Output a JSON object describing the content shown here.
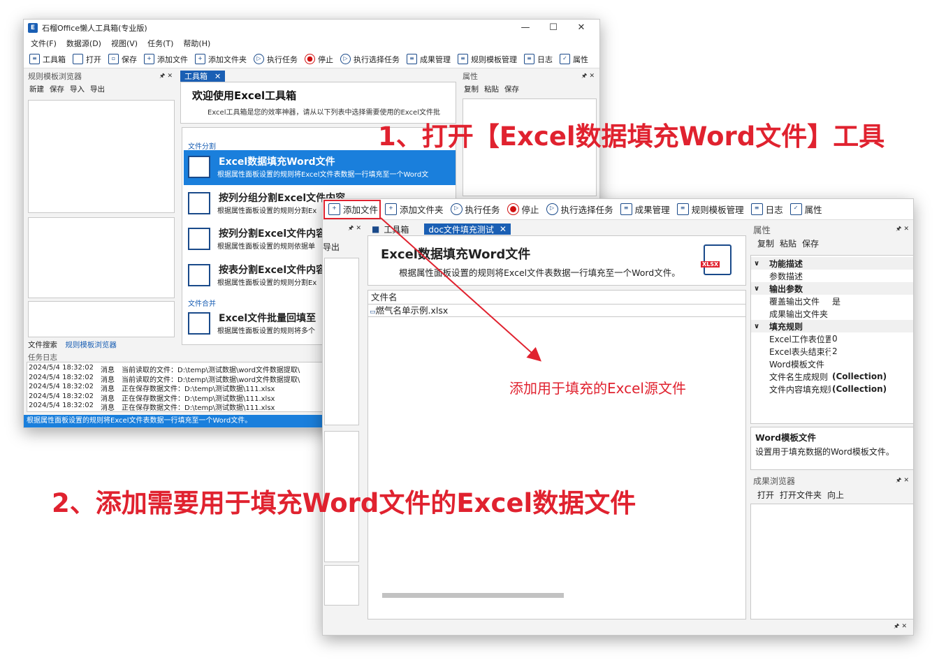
{
  "win1": {
    "title": "石榴Office懒人工具箱(专业版)",
    "app_icon": "E",
    "menu": [
      "文件(F)",
      "数据源(D)",
      "视图(V)",
      "任务(T)",
      "帮助(H)"
    ],
    "toolbar": [
      "工具箱",
      "打开",
      "保存",
      "添加文件",
      "添加文件夹",
      "执行任务",
      "停止",
      "执行选择任务",
      "成果管理",
      "规则模板管理",
      "日志",
      "属性"
    ],
    "rule_browser": {
      "title": "规则模板浏览器",
      "tools": [
        "新建",
        "保存",
        "导入",
        "导出"
      ],
      "tabs": [
        "文件搜索",
        "规则模板浏览器"
      ]
    },
    "tab_label": "工具箱",
    "welcome": {
      "title": "欢迎使用Excel工具箱",
      "desc": "Excel工具箱是您的效率神器，请从以下列表中选择需要使用的Excel文件批"
    },
    "group1": "文件分割",
    "group2": "文件合并",
    "tools": [
      {
        "title": "Excel数据填充Word文件",
        "desc": "根据属性面板设置的规则将Excel文件表数据一行填充至一个Word文"
      },
      {
        "title": "按列分组分割Excel文件内容",
        "desc": "根据属性面板设置的规则分割Ex"
      },
      {
        "title": "按列分割Excel文件内容",
        "desc": "根据属性面板设置的规则依据单"
      },
      {
        "title": "按表分割Excel文件内容",
        "desc": "根据属性面板设置的规则分割Ex"
      },
      {
        "title": "Excel文件批量回填至",
        "desc": "根据属性面板设置的规则将多个"
      }
    ],
    "props": {
      "title": "属性",
      "tools": [
        "复制",
        "粘贴",
        "保存"
      ]
    },
    "log": {
      "title": "任务日志",
      "rows": [
        {
          "time": "2024/5/4 18:32:02",
          "type": "消息",
          "text": "当前读取的文件：D:\\temp\\测试数据\\word文件数据提取\\"
        },
        {
          "time": "2024/5/4 18:32:02",
          "type": "消息",
          "text": "当前读取的文件：D:\\temp\\测试数据\\word文件数据提取\\"
        },
        {
          "time": "2024/5/4 18:32:02",
          "type": "消息",
          "text": "正在保存数据文件：D:\\temp\\测试数据\\111.xlsx"
        },
        {
          "time": "2024/5/4 18:32:02",
          "type": "消息",
          "text": "正在保存数据文件：D:\\temp\\测试数据\\111.xlsx"
        },
        {
          "time": "2024/5/4 18:32:02",
          "type": "消息",
          "text": "正在保存数据文件：D:\\temp\\测试数据\\111.xlsx"
        }
      ]
    },
    "status": "根据属性面板设置的规则将Excel文件表数据一行填充至一个Word文件。"
  },
  "win2": {
    "toolbar": [
      "添加文件",
      "添加文件夹",
      "执行任务",
      "停止",
      "执行选择任务",
      "成果管理",
      "规则模板管理",
      "日志",
      "属性"
    ],
    "left_stub": "导出",
    "tabs": [
      "工具箱",
      "doc文件填充测试"
    ],
    "tool_title": "Excel数据填充Word文件",
    "tool_desc": "根据属性面板设置的规则将Excel文件表数据一行填充至一个Word文件。",
    "tool_icon_badge": "XLSX",
    "file_list": {
      "header": "文件名",
      "files": [
        "燃气名单示例.xlsx"
      ]
    },
    "props": {
      "title": "属性",
      "tools": [
        "复制",
        "粘贴",
        "保存"
      ],
      "categories": [
        {
          "name": "功能描述",
          "rows": [
            {
              "name": "参数描述",
              "value": ""
            }
          ]
        },
        {
          "name": "输出参数",
          "rows": [
            {
              "name": "覆盖输出文件",
              "value": "是"
            },
            {
              "name": "成果输出文件夹",
              "value": ""
            }
          ]
        },
        {
          "name": "填充规则",
          "rows": [
            {
              "name": "Excel工作表位置",
              "value": "0"
            },
            {
              "name": "Excel表头结束行",
              "value": "2"
            },
            {
              "name": "Word模板文件",
              "value": ""
            },
            {
              "name": "文件名生成规则",
              "value": "(Collection)"
            },
            {
              "name": "文件内容填充规则",
              "value": "(Collection)"
            }
          ]
        }
      ],
      "help_title": "Word模板文件",
      "help_desc": "设置用于填充数据的Word模板文件。"
    },
    "result_browser": {
      "title": "成果浏览器",
      "tools": [
        "打开",
        "打开文件夹",
        "向上"
      ]
    }
  },
  "annotations": {
    "step1": "1、打开【Excel数据填充Word文件】工具",
    "step2": "2、添加需要用于填充Word文件的Excel数据文件",
    "note": "添加用于填充的Excel源文件"
  },
  "colors": {
    "accent": "#1a7fdc",
    "annotation": "#e0222f"
  }
}
